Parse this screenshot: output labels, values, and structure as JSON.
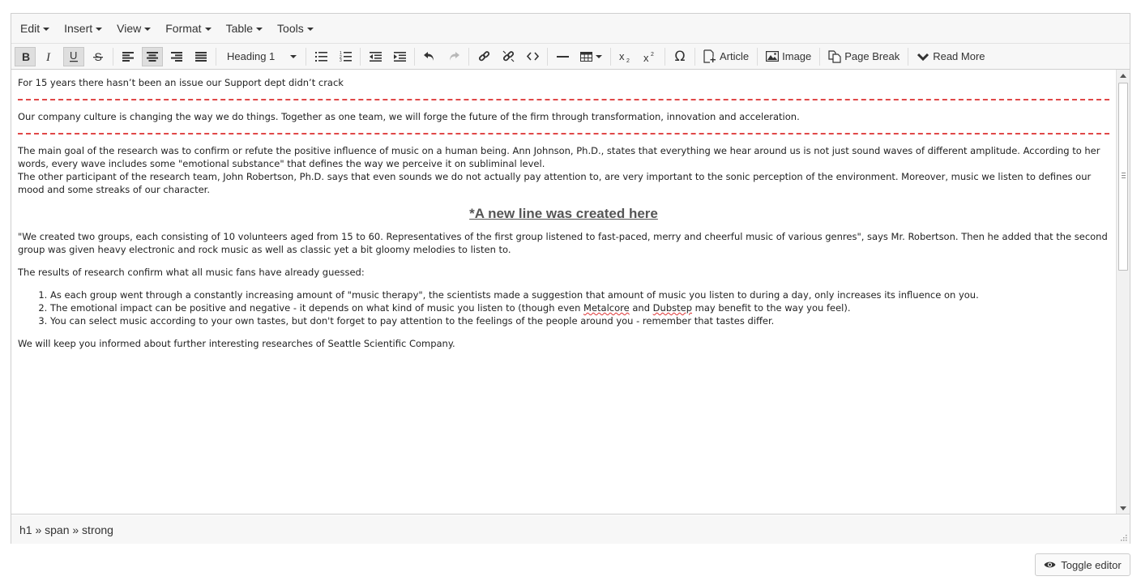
{
  "menubar": {
    "items": [
      {
        "label": "Edit"
      },
      {
        "label": "Insert"
      },
      {
        "label": "View"
      },
      {
        "label": "Format"
      },
      {
        "label": "Table"
      },
      {
        "label": "Tools"
      }
    ]
  },
  "toolbar": {
    "format_select": "Heading 1",
    "article_label": "Article",
    "image_label": "Image",
    "page_break_label": "Page Break",
    "read_more_label": "Read More",
    "omega_glyph": "Ω",
    "active_buttons": [
      "bold",
      "underline",
      "align-center"
    ]
  },
  "content": {
    "line1": "For 15 years there hasn’t been an issue our Support dept didn’t crack",
    "line2": "Our company culture is changing the way we do things. Together as one team, we will forge the future of the firm through transformation, innovation and acceleration.",
    "para1": "The main goal of the research was to confirm or refute the positive influence of music on a human being. Ann Johnson, Ph.D., states that everything we hear around us is not just sound waves of different amplitude. According to her words, every wave includes some \"emotional substance\" that defines the way we perceive it on subliminal level.",
    "para2": "The other participant of the research team, John Robertson, Ph.D. says that even sounds we do not actually pay attention to, are very important to the sonic perception of the environment. Moreover, music we listen to defines our mood and some streaks of our character.",
    "heading": "*A new line was created here",
    "para3": "\"We created two groups, each consisting of 10 volunteers aged from 15 to 60. Representatives of the first group listened to fast-paced, merry and cheerful music of various genres\", says Mr. Robertson. Then he added that the second group was given heavy electronic and rock music as well as classic yet a bit gloomy melodies to listen to.",
    "para4": "The results of research confirm what all music fans have already guessed:",
    "list": {
      "item1": "As each group went through a constantly increasing amount of \"music therapy\", the scientists made a suggestion that amount of music you listen to during a day, only increases its influence on you.",
      "item2_a": "The emotional impact can be positive and negative - it depends on what kind of music you listen to (though even ",
      "item2_b": "Metalcore",
      "item2_c": " and ",
      "item2_d": "Dubstep",
      "item2_e": " may benefit to the way you feel).",
      "item3": "You can select music according to your own tastes, but don't forget to pay attention to the feelings of the people around you - remember that tastes differ."
    },
    "para5": "We will keep you informed about further interesting researches of Seattle Scientific Company."
  },
  "statusbar": {
    "path": "h1 » span » strong"
  },
  "toggle": {
    "label": "Toggle editor"
  }
}
